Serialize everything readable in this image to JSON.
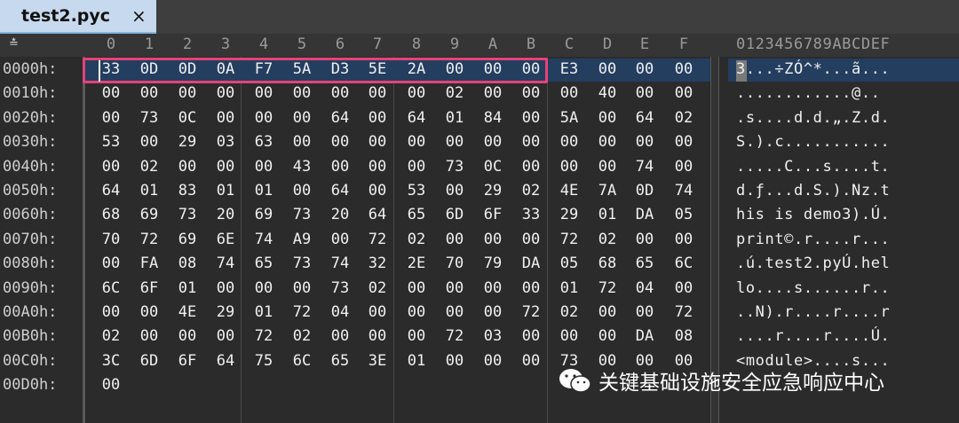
{
  "tab": {
    "title": "test2.pyc",
    "close": "×"
  },
  "header": {
    "corner_icon": "sort-up-icon",
    "corner_glyph": "≛",
    "columns": [
      "0",
      "1",
      "2",
      "3",
      "4",
      "5",
      "6",
      "7",
      "8",
      "9",
      "A",
      "B",
      "C",
      "D",
      "E",
      "F"
    ],
    "ascii_header": "0123456789ABCDEF"
  },
  "rows": [
    {
      "addr": "0000h:",
      "hex": [
        "33",
        "0D",
        "0D",
        "0A",
        "F7",
        "5A",
        "D3",
        "5E",
        "2A",
        "00",
        "00",
        "00",
        "E3",
        "00",
        "00",
        "00"
      ],
      "ascii": "3...÷ZÓ^*...ã..."
    },
    {
      "addr": "0010h:",
      "hex": [
        "00",
        "00",
        "00",
        "00",
        "00",
        "00",
        "00",
        "00",
        "00",
        "02",
        "00",
        "00",
        "00",
        "40",
        "00",
        "00"
      ],
      "ascii": "............@.."
    },
    {
      "addr": "0020h:",
      "hex": [
        "00",
        "73",
        "0C",
        "00",
        "00",
        "00",
        "64",
        "00",
        "64",
        "01",
        "84",
        "00",
        "5A",
        "00",
        "64",
        "02"
      ],
      "ascii": ".s....d.d.„.Z.d."
    },
    {
      "addr": "0030h:",
      "hex": [
        "53",
        "00",
        "29",
        "03",
        "63",
        "00",
        "00",
        "00",
        "00",
        "00",
        "00",
        "00",
        "00",
        "00",
        "00",
        "00"
      ],
      "ascii": "S.).c..........."
    },
    {
      "addr": "0040h:",
      "hex": [
        "00",
        "02",
        "00",
        "00",
        "00",
        "43",
        "00",
        "00",
        "00",
        "73",
        "0C",
        "00",
        "00",
        "00",
        "74",
        "00"
      ],
      "ascii": ".....C...s....t."
    },
    {
      "addr": "0050h:",
      "hex": [
        "64",
        "01",
        "83",
        "01",
        "01",
        "00",
        "64",
        "00",
        "53",
        "00",
        "29",
        "02",
        "4E",
        "7A",
        "0D",
        "74"
      ],
      "ascii": "d.ƒ...d.S.).Nz.t"
    },
    {
      "addr": "0060h:",
      "hex": [
        "68",
        "69",
        "73",
        "20",
        "69",
        "73",
        "20",
        "64",
        "65",
        "6D",
        "6F",
        "33",
        "29",
        "01",
        "DA",
        "05"
      ],
      "ascii": "his is demo3).Ú."
    },
    {
      "addr": "0070h:",
      "hex": [
        "70",
        "72",
        "69",
        "6E",
        "74",
        "A9",
        "00",
        "72",
        "02",
        "00",
        "00",
        "00",
        "72",
        "02",
        "00",
        "00"
      ],
      "ascii": "print©.r....r..."
    },
    {
      "addr": "0080h:",
      "hex": [
        "00",
        "FA",
        "08",
        "74",
        "65",
        "73",
        "74",
        "32",
        "2E",
        "70",
        "79",
        "DA",
        "05",
        "68",
        "65",
        "6C"
      ],
      "ascii": ".ú.test2.pyÚ.hel"
    },
    {
      "addr": "0090h:",
      "hex": [
        "6C",
        "6F",
        "01",
        "00",
        "00",
        "00",
        "73",
        "02",
        "00",
        "00",
        "00",
        "00",
        "01",
        "72",
        "04",
        "00"
      ],
      "ascii": "lo....s......r.."
    },
    {
      "addr": "00A0h:",
      "hex": [
        "00",
        "00",
        "4E",
        "29",
        "01",
        "72",
        "04",
        "00",
        "00",
        "00",
        "00",
        "72",
        "02",
        "00",
        "00",
        "72"
      ],
      "ascii": "..N).r....r....r"
    },
    {
      "addr": "00B0h:",
      "hex": [
        "02",
        "00",
        "00",
        "00",
        "72",
        "02",
        "00",
        "00",
        "00",
        "72",
        "03",
        "00",
        "00",
        "00",
        "DA",
        "08"
      ],
      "ascii": "....r....r....Ú."
    },
    {
      "addr": "00C0h:",
      "hex": [
        "3C",
        "6D",
        "6F",
        "64",
        "75",
        "6C",
        "65",
        "3E",
        "01",
        "00",
        "00",
        "00",
        "73",
        "00",
        "00",
        "00"
      ],
      "ascii": "<module>....s..."
    },
    {
      "addr": "00D0h:",
      "hex": [
        "00"
      ],
      "ascii": ""
    }
  ],
  "watermark": {
    "icon": "wechat-icon",
    "text": "关键基础设施安全应急响应中心"
  },
  "colors": {
    "background": "#2b2b2b",
    "tab_active": "#c7d9ee",
    "selection_border": "#e64277",
    "row_highlight": "#243e60"
  }
}
